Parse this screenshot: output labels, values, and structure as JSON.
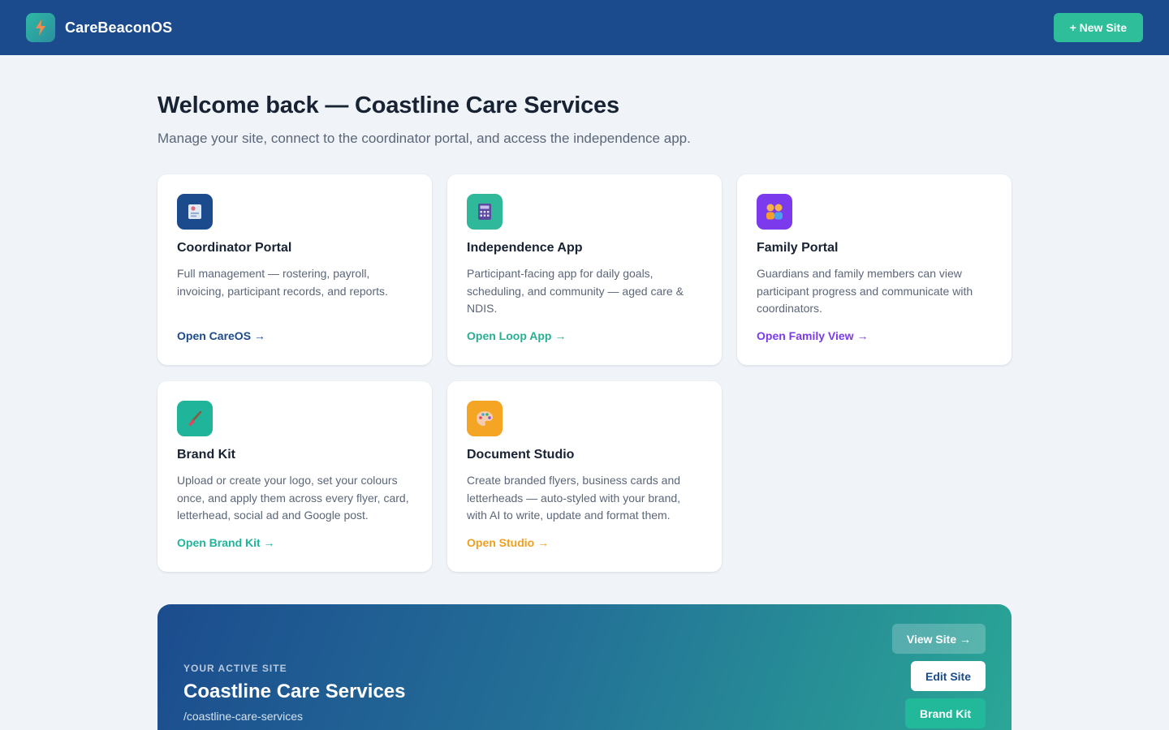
{
  "app": {
    "name": "CareBeaconOS",
    "logo_icon": "bolt-icon"
  },
  "header": {
    "new_site_label": "+ New Site"
  },
  "welcome": {
    "title": "Welcome back — Coastline Care Services",
    "subtitle": "Manage your site, connect to the coordinator portal, and access the independence app."
  },
  "cards": [
    {
      "icon": "id-badge-icon",
      "icon_bg": "#1b4b8c",
      "title": "Coordinator Portal",
      "description": "Full management — rostering, payroll, invoicing, participant records, and reports.",
      "link": "Open CareOS →",
      "link_color": "#1b4b8c"
    },
    {
      "icon": "calculator-icon",
      "icon_bg": "#2fb89a",
      "title": "Independence App",
      "description": "Participant-facing app for daily goals, scheduling, and community — aged care & NDIS.",
      "link": "Open Loop App →",
      "link_color": "#2aae93"
    },
    {
      "icon": "family-icon",
      "icon_bg": "#7c3aed",
      "title": "Family Portal",
      "description": "Guardians and family members can view participant progress and communicate with coordinators.",
      "link": "Open Family View →",
      "link_color": "#7c3aed"
    },
    {
      "icon": "paintbrush-icon",
      "icon_bg": "#20b49a",
      "title": "Brand Kit",
      "description": "Upload or create your logo, set your colours once, and apply them across every flyer, card, letterhead, social ad and Google post.",
      "link": "Open Brand Kit →",
      "link_color": "#20b49a"
    },
    {
      "icon": "palette-icon",
      "icon_bg": "#f5a524",
      "title": "Document Studio",
      "description": "Create branded flyers, business cards and letterheads — auto-styled with your brand, with AI to write, update and format them.",
      "link": "Open Studio →",
      "link_color": "#f0a020"
    }
  ],
  "active_site": {
    "eyebrow": "YOUR ACTIVE SITE",
    "name": "Coastline Care Services",
    "slug": "/coastline-care-services",
    "view_label": "View Site →",
    "edit_label": "Edit Site",
    "brand_label": "Brand Kit"
  },
  "colors": {
    "header_bg": "#1b4b8c",
    "page_bg": "#f0f4f8",
    "accent": "#2ebf9a"
  }
}
